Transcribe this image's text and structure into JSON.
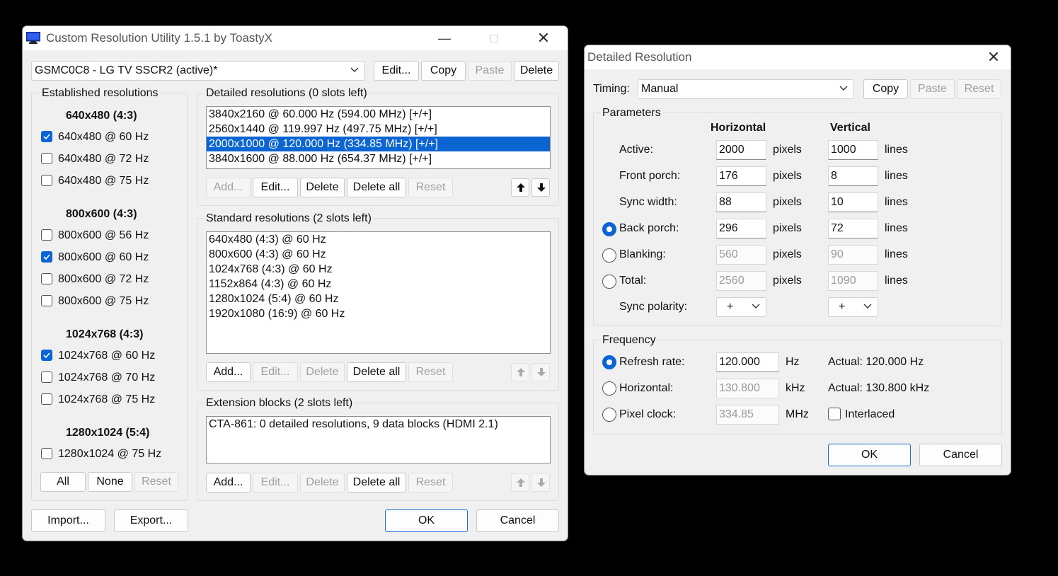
{
  "main": {
    "title": "Custom Resolution Utility 1.5.1 by ToastyX",
    "monitor_select": "GSMC0C8 - LG TV SSCR2 (active)*",
    "top_buttons": {
      "edit": "Edit...",
      "copy": "Copy",
      "paste": "Paste",
      "delete": "Delete"
    },
    "established": {
      "label": "Established resolutions",
      "groups": [
        {
          "header": "640x480 (4:3)",
          "items": [
            {
              "label": "640x480 @ 60 Hz",
              "checked": true
            },
            {
              "label": "640x480 @ 72 Hz",
              "checked": false
            },
            {
              "label": "640x480 @ 75 Hz",
              "checked": false
            }
          ]
        },
        {
          "header": "800x600 (4:3)",
          "items": [
            {
              "label": "800x600 @ 56 Hz",
              "checked": false
            },
            {
              "label": "800x600 @ 60 Hz",
              "checked": true
            },
            {
              "label": "800x600 @ 72 Hz",
              "checked": false
            },
            {
              "label": "800x600 @ 75 Hz",
              "checked": false
            }
          ]
        },
        {
          "header": "1024x768 (4:3)",
          "items": [
            {
              "label": "1024x768 @ 60 Hz",
              "checked": true
            },
            {
              "label": "1024x768 @ 70 Hz",
              "checked": false
            },
            {
              "label": "1024x768 @ 75 Hz",
              "checked": false
            }
          ]
        },
        {
          "header": "1280x1024 (5:4)",
          "items": [
            {
              "label": "1280x1024 @ 75 Hz",
              "checked": false
            }
          ]
        }
      ],
      "buttons": {
        "all": "All",
        "none": "None",
        "reset": "Reset"
      }
    },
    "detailed": {
      "label": "Detailed resolutions (0 slots left)",
      "items": [
        "3840x2160 @ 60.000 Hz (594.00 MHz) [+/+]",
        "2560x1440 @ 119.997 Hz (497.75 MHz) [+/+]",
        "2000x1000 @ 120.000 Hz (334.85 MHz) [+/+]",
        "3840x1600 @ 88.000 Hz (654.37 MHz) [+/+]"
      ],
      "selected_index": 2,
      "buttons": {
        "add": "Add...",
        "edit": "Edit...",
        "delete": "Delete",
        "delete_all": "Delete all",
        "reset": "Reset"
      }
    },
    "standard": {
      "label": "Standard resolutions (2 slots left)",
      "items": [
        "640x480 (4:3) @ 60 Hz",
        "800x600 (4:3) @ 60 Hz",
        "1024x768 (4:3) @ 60 Hz",
        "1152x864 (4:3) @ 60 Hz",
        "1280x1024 (5:4) @ 60 Hz",
        "1920x1080 (16:9) @ 60 Hz"
      ],
      "buttons": {
        "add": "Add...",
        "edit": "Edit...",
        "delete": "Delete",
        "delete_all": "Delete all",
        "reset": "Reset"
      }
    },
    "extension": {
      "label": "Extension blocks (2 slots left)",
      "items": [
        "CTA-861: 0 detailed resolutions, 9 data blocks (HDMI 2.1)"
      ],
      "buttons": {
        "add": "Add...",
        "edit": "Edit...",
        "delete": "Delete",
        "delete_all": "Delete all",
        "reset": "Reset"
      }
    },
    "bottom": {
      "import": "Import...",
      "export": "Export...",
      "ok": "OK",
      "cancel": "Cancel"
    }
  },
  "detail": {
    "title": "Detailed Resolution",
    "timing_label": "Timing:",
    "timing_value": "Manual",
    "buttons": {
      "copy": "Copy",
      "paste": "Paste",
      "reset": "Reset"
    },
    "parameters": {
      "label": "Parameters",
      "col_h": "Horizontal",
      "col_v": "Vertical",
      "unit_h": "pixels",
      "unit_v": "lines",
      "rows": [
        {
          "label": "Active:",
          "h": "2000",
          "v": "1000",
          "radio": null,
          "disabled": false
        },
        {
          "label": "Front porch:",
          "h": "176",
          "v": "8",
          "radio": null,
          "disabled": false
        },
        {
          "label": "Sync width:",
          "h": "88",
          "v": "10",
          "radio": null,
          "disabled": false
        },
        {
          "label": "Back porch:",
          "h": "296",
          "v": "72",
          "radio": true,
          "disabled": false
        },
        {
          "label": "Blanking:",
          "h": "560",
          "v": "90",
          "radio": false,
          "disabled": true
        },
        {
          "label": "Total:",
          "h": "2560",
          "v": "1090",
          "radio": false,
          "disabled": true
        }
      ],
      "sync_label": "Sync polarity:",
      "sync_h": "+",
      "sync_v": "+"
    },
    "frequency": {
      "label": "Frequency",
      "rows": [
        {
          "label": "Refresh rate:",
          "value": "120.000",
          "unit": "Hz",
          "extra": "Actual: 120.000 Hz",
          "selected": true
        },
        {
          "label": "Horizontal:",
          "value": "130.800",
          "unit": "kHz",
          "extra": "Actual: 130.800 kHz",
          "selected": false
        },
        {
          "label": "Pixel clock:",
          "value": "334.85",
          "unit": "MHz",
          "extra": "",
          "selected": false
        }
      ],
      "interlaced_label": "Interlaced"
    },
    "ok": "OK",
    "cancel": "Cancel"
  }
}
